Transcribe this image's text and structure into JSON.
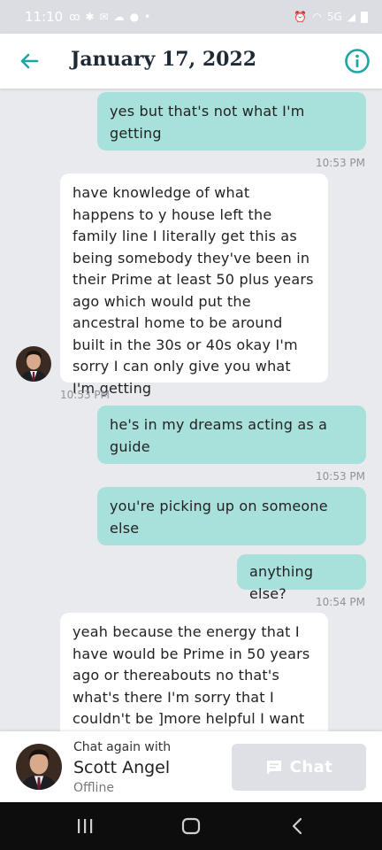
{
  "status_bar": {
    "time": "11:10",
    "network": "5G"
  },
  "header": {
    "title": "January 17, 2022",
    "back_icon": "arrow-left-icon",
    "info_icon": "info-circle-icon",
    "accent_color": "#1ea6a6"
  },
  "messages": [
    {
      "direction": "out",
      "text": "yes but that's not what I'm getting",
      "time": "10:53 PM"
    },
    {
      "direction": "in",
      "text": "have knowledge of what happens to y house left the family line I literally get this as being somebody they've been in their Prime at least 50 plus years ago which would put the ancestral home to be around built in the 30s or 40s okay I'm sorry I can only give you what I'm getting",
      "time": "10:53 PM"
    },
    {
      "direction": "out",
      "text": "he's in my dreams acting as a guide",
      "time": "10:53 PM"
    },
    {
      "direction": "out",
      "text": "you're picking up on someone else",
      "time": ""
    },
    {
      "direction": "out",
      "text": "anything else?",
      "time": "10:54 PM"
    },
    {
      "direction": "in",
      "text": "yeah because the energy that I have would be Prime in 50 years ago or thereabouts no that's what's there I'm sorry that I couldn't be ]more helpful I want",
      "time": ""
    }
  ],
  "footer": {
    "chat_again_label": "Chat again with",
    "advisor_name": "Scott Angel",
    "advisor_status": "Offline",
    "chat_button_label": "Chat",
    "chat_icon": "chat-bubble-icon"
  },
  "colors": {
    "outgoing_bubble": "#a8e1dc",
    "incoming_bubble": "#ffffff",
    "background": "#e9eaee"
  }
}
